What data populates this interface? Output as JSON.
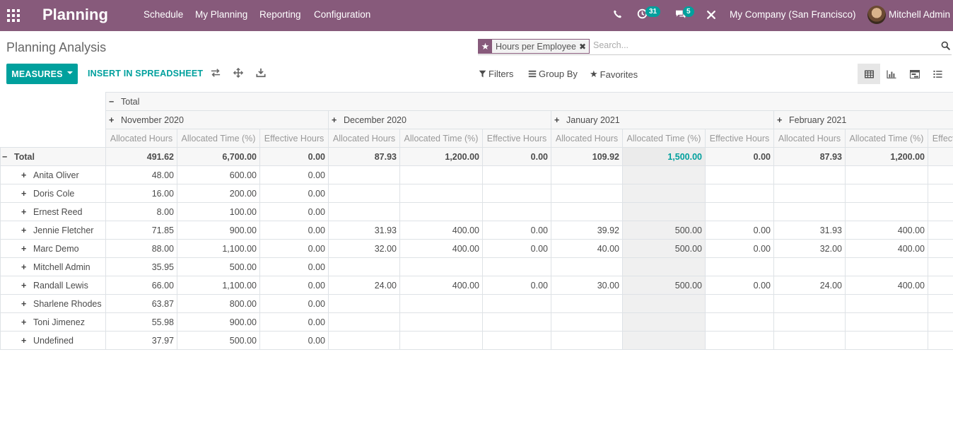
{
  "navbar": {
    "app_title": "Planning",
    "menu": [
      "Schedule",
      "My Planning",
      "Reporting",
      "Configuration"
    ],
    "activity_count": "31",
    "message_count": "5",
    "company": "My Company (San Francisco)",
    "user": "Mitchell Admin"
  },
  "control_panel": {
    "breadcrumb": "Planning Analysis",
    "facet_label": "Hours per Employee",
    "search_placeholder": "Search...",
    "measures_label": "MEASURES",
    "insert_label": "INSERT IN SPREADSHEET",
    "filters_label": "Filters",
    "group_by_label": "Group By",
    "favorites_label": "Favorites"
  },
  "pivot": {
    "total_label": "Total",
    "months": [
      "November 2020",
      "December 2020",
      "January 2021",
      "February 2021"
    ],
    "measures": [
      "Allocated Hours",
      "Allocated Time (%)",
      "Effective Hours"
    ],
    "total_row": {
      "label": "Total",
      "cells": [
        "491.62",
        "6,700.00",
        "0.00",
        "87.93",
        "1,200.00",
        "0.00",
        "109.92",
        "1,500.00",
        "0.00",
        "87.93",
        "1,200.00",
        ""
      ]
    },
    "rows": [
      {
        "label": "Anita Oliver",
        "cells": [
          "48.00",
          "600.00",
          "0.00",
          "",
          "",
          "",
          "",
          "",
          "",
          "",
          "",
          ""
        ]
      },
      {
        "label": "Doris Cole",
        "cells": [
          "16.00",
          "200.00",
          "0.00",
          "",
          "",
          "",
          "",
          "",
          "",
          "",
          "",
          ""
        ]
      },
      {
        "label": "Ernest Reed",
        "cells": [
          "8.00",
          "100.00",
          "0.00",
          "",
          "",
          "",
          "",
          "",
          "",
          "",
          "",
          ""
        ]
      },
      {
        "label": "Jennie Fletcher",
        "cells": [
          "71.85",
          "900.00",
          "0.00",
          "31.93",
          "400.00",
          "0.00",
          "39.92",
          "500.00",
          "0.00",
          "31.93",
          "400.00",
          ""
        ]
      },
      {
        "label": "Marc Demo",
        "cells": [
          "88.00",
          "1,100.00",
          "0.00",
          "32.00",
          "400.00",
          "0.00",
          "40.00",
          "500.00",
          "0.00",
          "32.00",
          "400.00",
          ""
        ]
      },
      {
        "label": "Mitchell Admin",
        "cells": [
          "35.95",
          "500.00",
          "0.00",
          "",
          "",
          "",
          "",
          "",
          "",
          "",
          "",
          ""
        ]
      },
      {
        "label": "Randall Lewis",
        "cells": [
          "66.00",
          "1,100.00",
          "0.00",
          "24.00",
          "400.00",
          "0.00",
          "30.00",
          "500.00",
          "0.00",
          "24.00",
          "400.00",
          ""
        ]
      },
      {
        "label": "Sharlene Rhodes",
        "cells": [
          "63.87",
          "800.00",
          "0.00",
          "",
          "",
          "",
          "",
          "",
          "",
          "",
          "",
          ""
        ]
      },
      {
        "label": "Toni Jimenez",
        "cells": [
          "55.98",
          "900.00",
          "0.00",
          "",
          "",
          "",
          "",
          "",
          "",
          "",
          "",
          ""
        ]
      },
      {
        "label": "Undefined",
        "cells": [
          "37.97",
          "500.00",
          "0.00",
          "",
          "",
          "",
          "",
          "",
          "",
          "",
          "",
          ""
        ]
      }
    ]
  }
}
